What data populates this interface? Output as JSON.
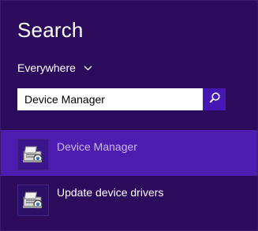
{
  "search": {
    "title": "Search",
    "scope_label": "Everywhere",
    "query": "Device Manager"
  },
  "results": [
    {
      "label": "Device Manager",
      "icon": "device-manager-icon",
      "selected": true
    },
    {
      "label": "Update device drivers",
      "icon": "device-manager-icon",
      "selected": false
    }
  ],
  "colors": {
    "background": "#2c0a5c",
    "selected_row": "#4d1db2",
    "search_button": "#4617b4"
  }
}
